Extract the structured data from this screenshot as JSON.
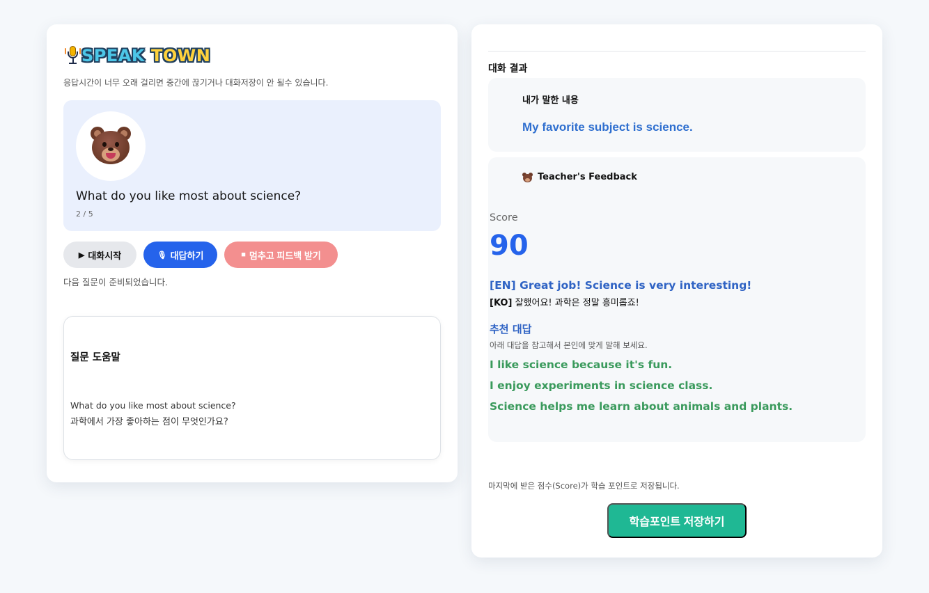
{
  "app": {
    "logo": {
      "speak": "SPEAK",
      "town": "TOWN"
    },
    "notice": "응답시간이 너무 오래 걸리면 중간에 끊기거나 대화저장이 안 될수 있습니다."
  },
  "question": {
    "text": "What do you like most about science?",
    "progress": "2 / 5"
  },
  "controls": {
    "start": {
      "icon": "▶",
      "label": "대화시작"
    },
    "answer": {
      "icon": "🎙",
      "label": "대답하기"
    },
    "stop": {
      "icon": "■",
      "label": "멈추고 피드백 받기"
    },
    "status": "다음 질문이 준비되었습니다."
  },
  "help": {
    "title": "질문 도움말",
    "english": "What do you like most about science?",
    "korean": "과학에서 가장 좋아하는 점이 무엇인가요?"
  },
  "results": {
    "title": "대화 결과",
    "said_label": "내가 말한 내용",
    "said_text": "My favorite subject is science.",
    "feedback_title": "Teacher's Feedback",
    "score_label": "Score",
    "score": "90",
    "feedback_en": "[EN] Great job! Science is very interesting!",
    "feedback_ko_tag": "[KO]",
    "feedback_ko": " 잘했어요! 과학은 정말 흥미롭죠!",
    "recommended_title": "추천 대답",
    "recommended_subtitle": "아래 대답을 참고해서 본인에 맞게 말해 보세요.",
    "recommended": [
      "I like science because it's fun.",
      "I enjoy experiments in science class.",
      "Science helps me learn about animals and plants."
    ]
  },
  "save": {
    "note": "마지막에 받은 점수(Score)가 학습 포인트로 저장됩니다.",
    "button": "학습포인트 저장하기"
  },
  "colors": {
    "accent_blue": "#2563eb",
    "stop_red": "#f38f8f",
    "save_green": "#1fb894",
    "recommend_green": "#3a9a5c"
  }
}
